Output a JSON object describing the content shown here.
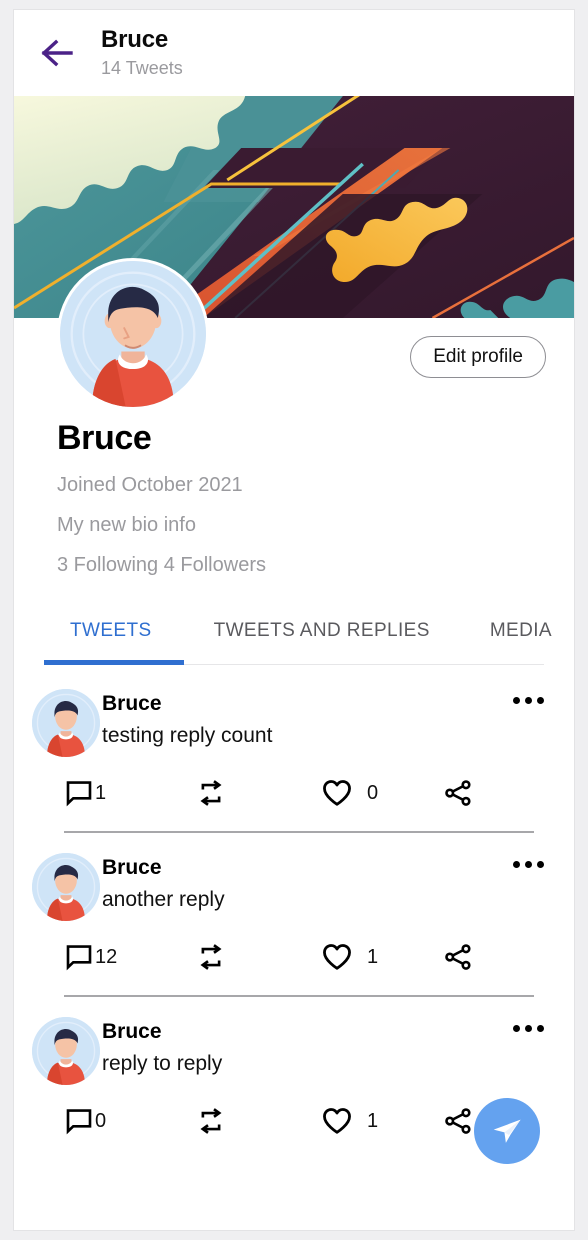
{
  "header": {
    "back_icon": "arrow-left-icon",
    "title": "Bruce",
    "subtitle": "14 Tweets",
    "back_color": "#4b2287"
  },
  "banner": {
    "icon": "profile-banner-illustration",
    "colors": {
      "teal": "#3f8b90",
      "teal_light": "#57a0a4",
      "cream": "#f2f4cf",
      "plum": "#3f1f33",
      "plum_dark": "#2e1526",
      "orange": "#e8603c",
      "yellow": "#f4b12c",
      "yellow_light": "#f9c14a"
    }
  },
  "profile": {
    "avatar_icon": "user-avatar",
    "edit_button_label": "Edit profile",
    "name": "Bruce",
    "joined": "Joined October 2021",
    "bio": "My new bio info",
    "stats": "3 Following 4 Followers"
  },
  "tabs": {
    "active_color": "#2f6fd0",
    "items": [
      {
        "label": "TWEETS",
        "active": true
      },
      {
        "label": "TWEETS AND REPLIES",
        "active": false
      },
      {
        "label": "MEDIA",
        "active": false
      }
    ]
  },
  "feed": {
    "more_icon": "more-horizontal-icon",
    "comment_icon": "comment-icon",
    "retweet_icon": "retweet-icon",
    "like_icon": "heart-icon",
    "share_icon": "share-icon",
    "tweets": [
      {
        "author": "Bruce",
        "text": "testing reply count",
        "comments": "1",
        "retweets": "",
        "likes": "0"
      },
      {
        "author": "Bruce",
        "text": "another reply",
        "comments": "12",
        "retweets": "",
        "likes": "1"
      },
      {
        "author": "Bruce",
        "text": "reply to reply",
        "comments": "0",
        "retweets": "",
        "likes": "1"
      }
    ]
  },
  "fab": {
    "icon": "send-icon",
    "color": "#64a2ef"
  }
}
